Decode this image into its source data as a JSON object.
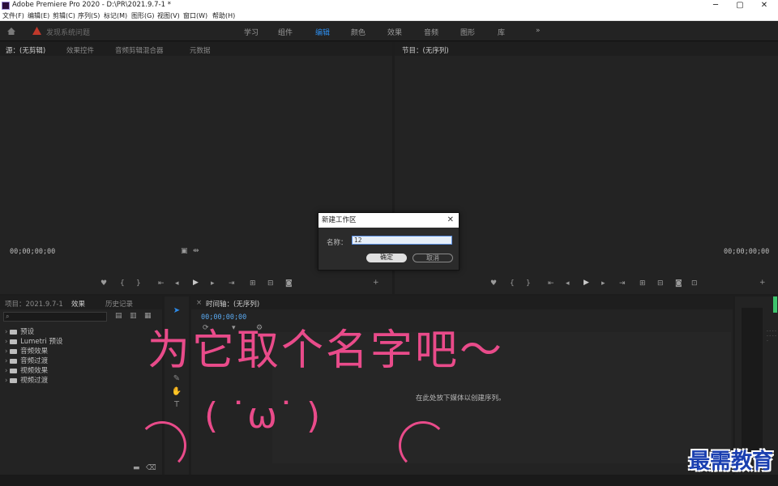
{
  "window": {
    "title": "Adobe Premiere Pro 2020 - D:\\PR\\2021.9.7-1 *",
    "minimize": "─",
    "maximize": "▢",
    "close": "✕"
  },
  "menu": [
    "文件(F)",
    "编辑(E)",
    "剪辑(C)",
    "序列(S)",
    "标记(M)",
    "图形(G)",
    "视图(V)",
    "窗口(W)",
    "帮助(H)"
  ],
  "workspace": {
    "home_icon": "home-icon",
    "alert_text": "发现系统问题",
    "tabs": [
      "学习",
      "组件",
      "编辑",
      "颜色",
      "效果",
      "音频",
      "图形",
      "库"
    ],
    "active_tab": "编辑",
    "more": "»"
  },
  "source_panel": {
    "tabs": [
      "源：(无剪辑)",
      "效果控件",
      "音频剪辑混合器",
      "元数据"
    ],
    "timecode_left": "00;00;00;00"
  },
  "program_panel": {
    "tabs": [
      "节目：(无序列)"
    ],
    "timecode_right": "00;00;00;00"
  },
  "project_panel": {
    "tabs": [
      "项目：2021.9.7-1",
      "效果",
      "历史记录"
    ],
    "items": [
      "预设",
      "Lumetri 预设",
      "音频效果",
      "音频过渡",
      "视频效果",
      "视频过渡"
    ]
  },
  "timeline_panel": {
    "tab": "时间轴：(无序列)",
    "timecode": "00;00;00;00",
    "empty_message": "在此处放下媒体以创建序列。"
  },
  "dialog": {
    "title": "新建工作区",
    "close": "✕",
    "name_label": "名称：",
    "name_value": "12",
    "ok": "确定",
    "cancel": "取消"
  },
  "overlay": {
    "caption": "为它取个名字吧～",
    "kaomoji": "( ˙ω˙ )"
  },
  "watermark": "最需教育",
  "colors": {
    "accent": "#2d8ceb",
    "overlay": "#e94b8a",
    "watermark": "#1a3fb0",
    "meter": "#3ec46d"
  }
}
